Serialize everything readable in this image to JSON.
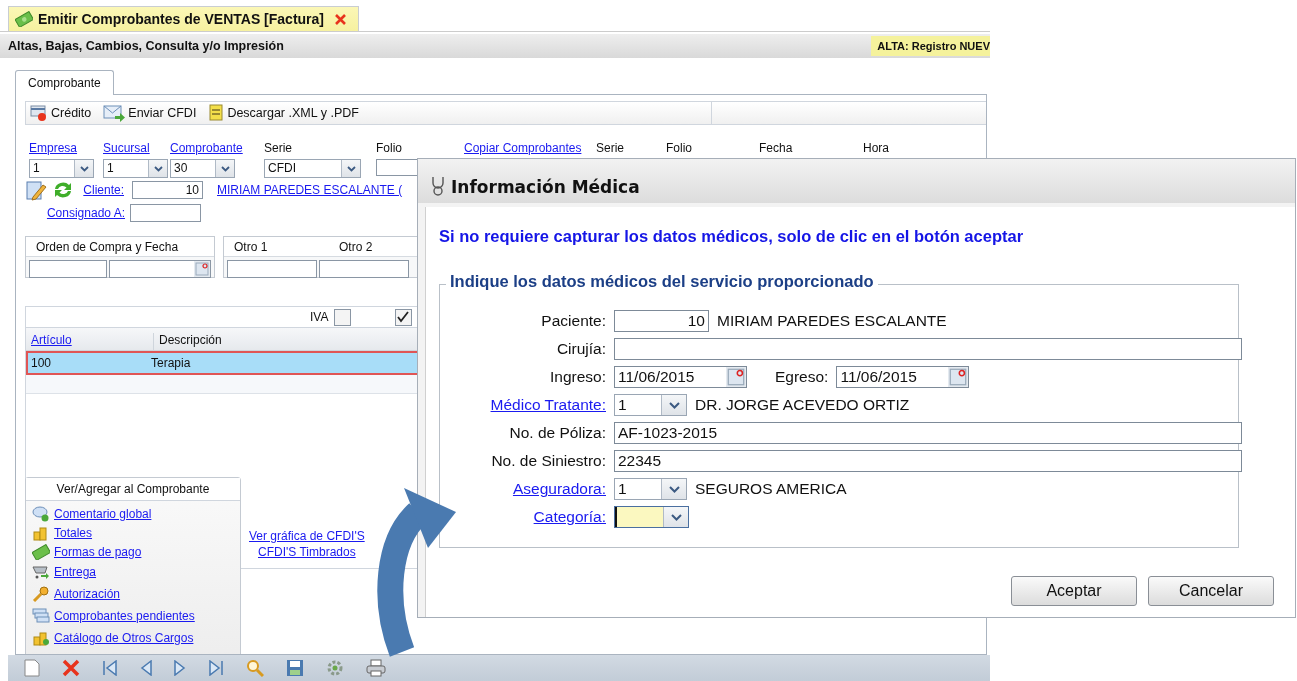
{
  "doc_tab": {
    "title": "Emitir Comprobantes de VENTAS [Factura]",
    "selected": true
  },
  "header": {
    "title": "Altas, Bajas, Cambios, Consulta y/o Impresión",
    "status": "ALTA: Registro NUEV"
  },
  "panel_tabs": [
    {
      "label": "Comprobante",
      "selected": true
    }
  ],
  "toolbar": [
    {
      "label": "Crédito"
    },
    {
      "label": "Enviar CFDI"
    },
    {
      "label": "Descargar .XML y .PDF"
    }
  ],
  "header_fields": [
    {
      "label": "Empresa",
      "link": true,
      "kind": "combo",
      "value": "1"
    },
    {
      "label": "Sucursal",
      "link": true,
      "kind": "combo",
      "value": "1"
    },
    {
      "label": "Comprobante",
      "link": true,
      "kind": "combo",
      "value": "30"
    },
    {
      "label": "Serie",
      "link": false,
      "kind": "combo",
      "value": "CFDI"
    },
    {
      "label": "Folio",
      "link": false,
      "kind": "input"
    },
    {
      "label": "Copiar Comprobantes",
      "link": true,
      "kind": "none"
    },
    {
      "label": "Serie",
      "link": false,
      "kind": "none"
    },
    {
      "label": "Folio",
      "link": false,
      "kind": "none"
    },
    {
      "label": "Fecha",
      "link": false,
      "kind": "none"
    },
    {
      "label": "Hora",
      "link": false,
      "kind": "none"
    }
  ],
  "cliente": {
    "label": "Cliente:",
    "value": "10",
    "name": "MIRIAM PAREDES ESCALANTE ("
  },
  "consignado": {
    "label": "Consignado A:"
  },
  "extra_boxes": [
    {
      "columns": [
        "Orden de Compra y Fecha"
      ],
      "inputs": [
        {
          "kind": "input"
        },
        {
          "kind": "date"
        }
      ]
    },
    {
      "columns": [
        "Otro 1",
        "Otro 2"
      ],
      "inputs": [
        {
          "kind": "input"
        },
        {
          "kind": "input"
        }
      ]
    }
  ],
  "options": [
    {
      "label": "IVA",
      "checked": false
    },
    {
      "checked": true
    }
  ],
  "grid": {
    "columns": [
      {
        "label": "Artículo",
        "link": true
      },
      {
        "label": "Descripción",
        "link": false
      }
    ],
    "rows": [
      {
        "cells": [
          "100",
          "Terapia"
        ],
        "selected": true
      }
    ]
  },
  "actions": {
    "title": "Ver/Agregar al Comprobante",
    "items": [
      "Comentario global",
      "Totales",
      "Formas de pago",
      "Entrega",
      "Autorización",
      "Comprobantes pendientes",
      "Catálogo de Otros Cargos"
    ]
  },
  "chart_links": [
    "Ver gráfica de CFDI'S",
    "CFDI'S Timbrados"
  ],
  "dialog": {
    "title": "Información Médica",
    "notice": "Si no requiere capturar los datos médicos, solo de clic en el botón aceptar",
    "legend": "Indique los datos médicos del servicio proporcionado",
    "rows": [
      {
        "kind": "number",
        "label": "Paciente:",
        "value": "10",
        "name": "MIRIAM PAREDES ESCALANTE"
      },
      {
        "kind": "text",
        "label": "Cirujía:"
      },
      {
        "kind": "dates",
        "label": "Ingreso:",
        "value": "11/06/2015",
        "label2": "Egreso:",
        "value2": "11/06/2015"
      },
      {
        "kind": "combo",
        "label": "Médico Tratante:",
        "value": "1",
        "name": "DR. JORGE ACEVEDO ORTIZ",
        "focused": false
      },
      {
        "kind": "text",
        "label": "No. de Póliza:",
        "value": "AF-1023-2015"
      },
      {
        "kind": "text",
        "label": "No. de Siniestro:",
        "value": "22345"
      },
      {
        "kind": "combo",
        "label": "Aseguradora:",
        "value": "1",
        "name": "SEGUROS AMERICA",
        "focused": false
      },
      {
        "kind": "combo",
        "label": "Categoría:",
        "focused": true
      }
    ],
    "buttons": [
      "Aceptar",
      "Cancelar"
    ]
  }
}
